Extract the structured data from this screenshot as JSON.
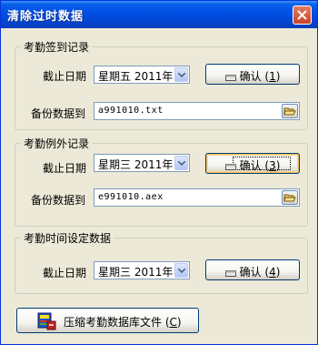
{
  "window": {
    "title": "清除过时数据",
    "close_icon": "close-icon"
  },
  "group1": {
    "legend": "考勤签到记录",
    "date_label": "截止日期",
    "date_value": "星期五  2011年 1",
    "confirm_label": "确认 (",
    "confirm_key": "1",
    "confirm_tail": ")",
    "backup_label": "备份数据到",
    "backup_value": "a991010.txt"
  },
  "group2": {
    "legend": "考勤例外记录",
    "date_label": "截止日期",
    "date_value": "星期三  2011年 1",
    "confirm_label": "确认 (",
    "confirm_key": "3",
    "confirm_tail": ")",
    "backup_label": "备份数据到",
    "backup_value": "e991010.aex"
  },
  "group3": {
    "legend": "考勤时间设定数据",
    "date_label": "截止日期",
    "date_value": "星期三  2011年 1",
    "confirm_label": "确认 (",
    "confirm_key": "4",
    "confirm_tail": ")"
  },
  "compress_button": {
    "label": "压缩考勤数据库文件 (",
    "key": "C",
    "tail": ")"
  },
  "colors": {
    "titlebar": "#0050E6",
    "dialog_bg": "#ECE9D8",
    "border": "#7F9DB9"
  }
}
